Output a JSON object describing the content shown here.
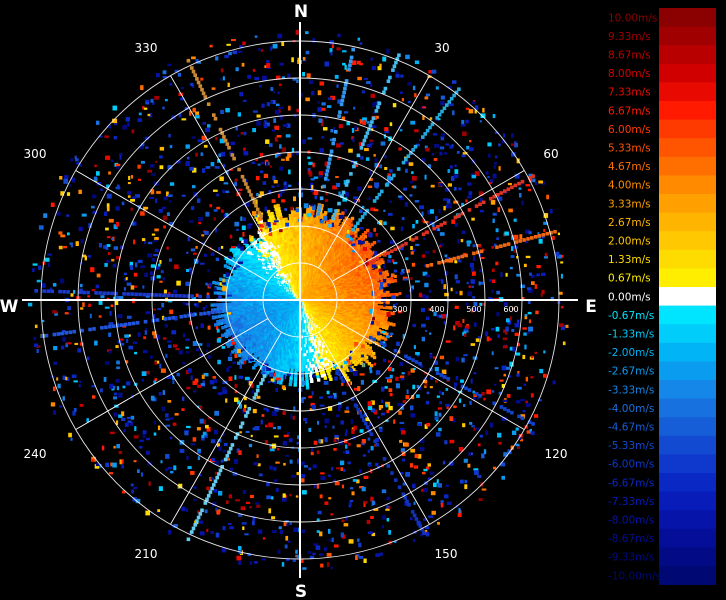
{
  "compass": {
    "north": "N",
    "east": "E",
    "south": "S",
    "west": "W"
  },
  "azimuth_labels": [
    "30",
    "60",
    "120",
    "150",
    "210",
    "240",
    "300",
    "330"
  ],
  "range_labels": [
    "300",
    "400",
    "500",
    "600"
  ],
  "colorbar": {
    "levels": [
      {
        "label": "10.00m/s",
        "color": "#8b0000"
      },
      {
        "label": "9.33m/s",
        "color": "#a00000"
      },
      {
        "label": "8.67m/s",
        "color": "#b80000"
      },
      {
        "label": "8.00m/s",
        "color": "#d00000"
      },
      {
        "label": "7.33m/s",
        "color": "#e80a00"
      },
      {
        "label": "6.67m/s",
        "color": "#ff1a00"
      },
      {
        "label": "6.00m/s",
        "color": "#ff3a00"
      },
      {
        "label": "5.33m/s",
        "color": "#ff5500"
      },
      {
        "label": "4.67m/s",
        "color": "#ff6f00"
      },
      {
        "label": "4.00m/s",
        "color": "#ff8a00"
      },
      {
        "label": "3.33m/s",
        "color": "#ffa000"
      },
      {
        "label": "2.67m/s",
        "color": "#ffb400"
      },
      {
        "label": "2.00m/s",
        "color": "#ffc800"
      },
      {
        "label": "1.33m/s",
        "color": "#ffdc00"
      },
      {
        "label": "0.67m/s",
        "color": "#ffee00"
      },
      {
        "label": "0.00m/s",
        "color": "#ffffff"
      },
      {
        "label": "-0.67m/s",
        "color": "#00e5ff"
      },
      {
        "label": "-1.33m/s",
        "color": "#00cdfa"
      },
      {
        "label": "-2.00m/s",
        "color": "#00b4f5"
      },
      {
        "label": "-2.67m/s",
        "color": "#0a9cef"
      },
      {
        "label": "-3.33m/s",
        "color": "#1487e8"
      },
      {
        "label": "-4.00m/s",
        "color": "#1772df"
      },
      {
        "label": "-4.67m/s",
        "color": "#155ed8"
      },
      {
        "label": "-5.33m/s",
        "color": "#124ad2"
      },
      {
        "label": "-6.00m/s",
        "color": "#0f38cc"
      },
      {
        "label": "-6.67m/s",
        "color": "#0a28c4"
      },
      {
        "label": "-7.33m/s",
        "color": "#081cba"
      },
      {
        "label": "-8.00m/s",
        "color": "#0614aa"
      },
      {
        "label": "-8.67m/s",
        "color": "#040e98"
      },
      {
        "label": "-9.33m/s",
        "color": "#020a86"
      },
      {
        "label": "-10.00m/s",
        "color": "#000874"
      }
    ]
  }
}
